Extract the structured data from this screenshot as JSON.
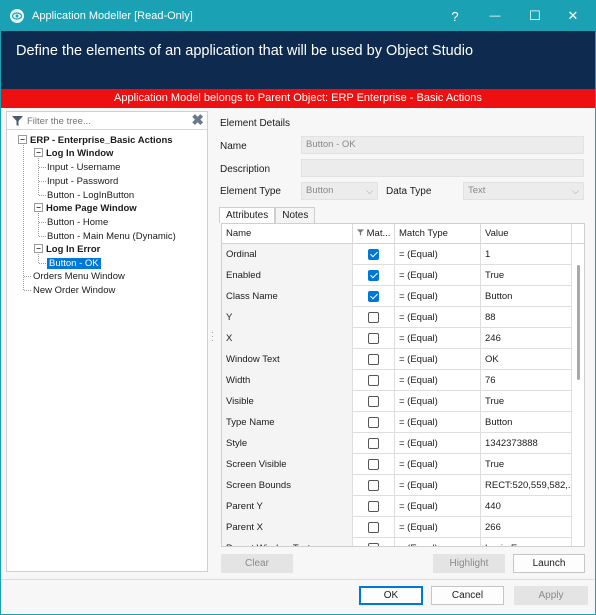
{
  "window": {
    "title": "Application Modeller [Read-Only]",
    "help_glyph": "?",
    "minimize_glyph": "—",
    "maximize_glyph": "☐",
    "close_glyph": "✕"
  },
  "header": {
    "text": "Define the elements of an application that will be used by Object Studio"
  },
  "banner": {
    "text": "Application Model belongs to Parent Object: ERP Enterprise - Basic Actions"
  },
  "tree": {
    "filter_placeholder": "Filter the tree...",
    "clear_glyph": "✖",
    "root": "ERP - Enterprise_Basic Actions",
    "nodes": [
      {
        "label": "Log In Window"
      },
      {
        "label": "Input - Username"
      },
      {
        "label": "Input - Password"
      },
      {
        "label": "Button - LogInButton"
      },
      {
        "label": "Home Page Window"
      },
      {
        "label": "Button - Home"
      },
      {
        "label": "Button - Main Menu (Dynamic)"
      },
      {
        "label": "Log In Error"
      },
      {
        "label": "Button - OK"
      },
      {
        "label": "Orders Menu Window"
      },
      {
        "label": "New Order Window"
      }
    ],
    "expander_glyph": "−"
  },
  "details": {
    "section_title": "Element Details",
    "name_label": "Name",
    "name_value": "Button - OK",
    "description_label": "Description",
    "description_value": "",
    "element_type_label": "Element Type",
    "element_type_value": "Button",
    "data_type_label": "Data Type",
    "data_type_value": "Text",
    "chevron_glyph": "⌵"
  },
  "tabs": [
    {
      "label": "Attributes"
    },
    {
      "label": "Notes"
    }
  ],
  "grid": {
    "headers": {
      "name": "Name",
      "match": "Mat...",
      "match_type": "Match Type",
      "value": "Value"
    },
    "rows": [
      {
        "name": "Ordinal",
        "checked": true,
        "match_type": "=  (Equal)",
        "value": "1"
      },
      {
        "name": "Enabled",
        "checked": true,
        "match_type": "=  (Equal)",
        "value": "True"
      },
      {
        "name": "Class Name",
        "checked": true,
        "match_type": "=  (Equal)",
        "value": "Button"
      },
      {
        "name": "Y",
        "checked": false,
        "match_type": "=  (Equal)",
        "value": "88"
      },
      {
        "name": "X",
        "checked": false,
        "match_type": "=  (Equal)",
        "value": "246"
      },
      {
        "name": "Window Text",
        "checked": false,
        "match_type": "=  (Equal)",
        "value": "OK"
      },
      {
        "name": "Width",
        "checked": false,
        "match_type": "=  (Equal)",
        "value": "76"
      },
      {
        "name": "Visible",
        "checked": false,
        "match_type": "=  (Equal)",
        "value": "True"
      },
      {
        "name": "Type Name",
        "checked": false,
        "match_type": "=  (Equal)",
        "value": "Button"
      },
      {
        "name": "Style",
        "checked": false,
        "match_type": "=  (Equal)",
        "value": "1342373888"
      },
      {
        "name": "Screen Visible",
        "checked": false,
        "match_type": "=  (Equal)",
        "value": "True"
      },
      {
        "name": "Screen Bounds",
        "checked": false,
        "match_type": "=  (Equal)",
        "value": "RECT:520,559,582,..."
      },
      {
        "name": "Parent Y",
        "checked": false,
        "match_type": "=  (Equal)",
        "value": "440"
      },
      {
        "name": "Parent X",
        "checked": false,
        "match_type": "=  (Equal)",
        "value": "266"
      },
      {
        "name": "Parent Window Text",
        "checked": false,
        "match_type": "=  (Equal)",
        "value": "Login Error"
      }
    ]
  },
  "buttons": {
    "clear": "Clear",
    "highlight": "Highlight",
    "launch": "Launch",
    "ok": "OK",
    "cancel": "Cancel",
    "apply": "Apply"
  },
  "colors": {
    "titlebar": "#1aa1b4",
    "header": "#0e2b4f",
    "banner": "#ee1010",
    "selection": "#0078d7"
  }
}
